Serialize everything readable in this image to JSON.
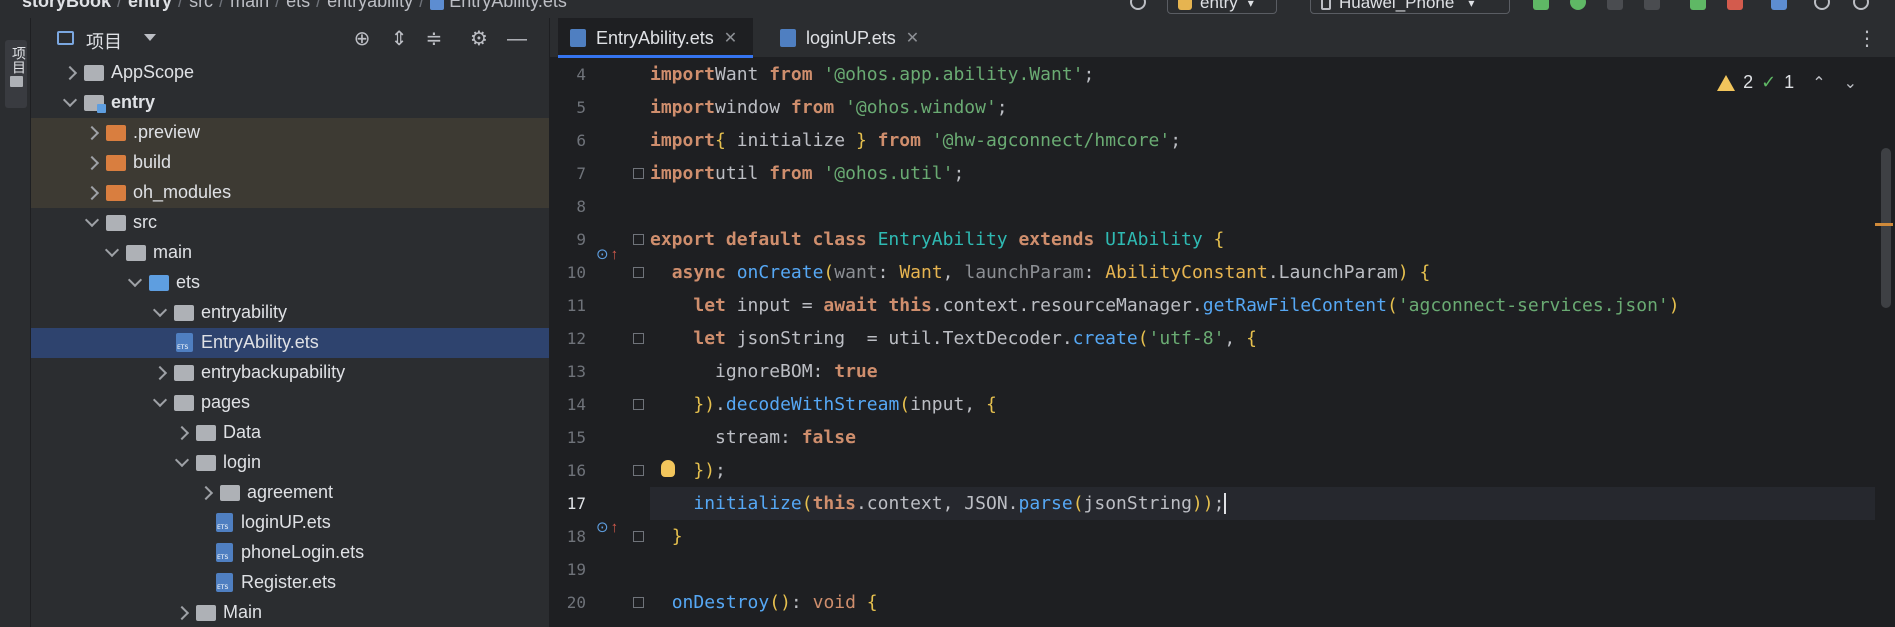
{
  "topbar": {
    "breadcrumb": [
      "storyBook",
      "entry",
      "src",
      "main",
      "ets",
      "entryability",
      "EntryAbility.ets"
    ],
    "run_config": "entry",
    "device": "Huawei_Phone"
  },
  "stripe": {
    "project_tab_label": "项目"
  },
  "project_panel": {
    "title": "项目",
    "tree": [
      {
        "label": "AppScope",
        "depth": 0,
        "state": "collapsed",
        "icon": "folder-gray"
      },
      {
        "label": "entry",
        "depth": 0,
        "state": "expanded",
        "icon": "module",
        "bold": true
      },
      {
        "label": ".preview",
        "depth": 1,
        "state": "collapsed",
        "icon": "folder-orange",
        "excluded": true
      },
      {
        "label": "build",
        "depth": 1,
        "state": "collapsed",
        "icon": "folder-orange",
        "excluded": true
      },
      {
        "label": "oh_modules",
        "depth": 1,
        "state": "collapsed",
        "icon": "folder-orange",
        "excluded": true
      },
      {
        "label": "src",
        "depth": 1,
        "state": "expanded",
        "icon": "folder-gray"
      },
      {
        "label": "main",
        "depth": 2,
        "state": "expanded",
        "icon": "folder-gray"
      },
      {
        "label": "ets",
        "depth": 3,
        "state": "expanded",
        "icon": "folder-blue"
      },
      {
        "label": "entryability",
        "depth": 4,
        "state": "expanded",
        "icon": "folder-gray"
      },
      {
        "label": "EntryAbility.ets",
        "depth": 5,
        "state": "file",
        "icon": "ets",
        "selected": true
      },
      {
        "label": "entrybackupability",
        "depth": 4,
        "state": "collapsed",
        "icon": "folder-gray"
      },
      {
        "label": "pages",
        "depth": 4,
        "state": "expanded",
        "icon": "folder-gray"
      },
      {
        "label": "Data",
        "depth": 5,
        "state": "collapsed",
        "icon": "folder-gray"
      },
      {
        "label": "login",
        "depth": 5,
        "state": "expanded",
        "icon": "folder-gray"
      },
      {
        "label": "agreement",
        "depth": 6,
        "state": "collapsed",
        "icon": "folder-gray"
      },
      {
        "label": "loginUP.ets",
        "depth": 7,
        "state": "file",
        "icon": "ets"
      },
      {
        "label": "phoneLogin.ets",
        "depth": 7,
        "state": "file",
        "icon": "ets"
      },
      {
        "label": "Register.ets",
        "depth": 7,
        "state": "file",
        "icon": "ets"
      },
      {
        "label": "Main",
        "depth": 5,
        "state": "collapsed",
        "icon": "folder-gray"
      }
    ]
  },
  "editor": {
    "tabs": [
      {
        "label": "EntryAbility.ets",
        "active": true
      },
      {
        "label": "loginUP.ets",
        "active": false
      }
    ],
    "inspections": {
      "warnings": "2",
      "weak_warnings": "1"
    },
    "current_line": 17,
    "lines": [
      {
        "n": "4",
        "segs": [
          [
            "kw",
            "import"
          ],
          [
            "",
            "Want "
          ],
          [
            "kw",
            "from "
          ],
          [
            "str",
            "'@ohos.app.ability.Want'"
          ],
          [
            "",
            ";"
          ]
        ]
      },
      {
        "n": "5",
        "segs": [
          [
            "kw",
            "import"
          ],
          [
            "",
            "window "
          ],
          [
            "kw",
            "from "
          ],
          [
            "str",
            "'@ohos.window'"
          ],
          [
            "",
            ";"
          ]
        ]
      },
      {
        "n": "6",
        "segs": [
          [
            "kw",
            "import"
          ],
          [
            "brace",
            "{ "
          ],
          [
            "",
            "initialize "
          ],
          [
            "brace",
            "} "
          ],
          [
            "kw",
            "from "
          ],
          [
            "str",
            "'@hw-agconnect/hmcore'"
          ],
          [
            "",
            ";"
          ]
        ]
      },
      {
        "n": "7",
        "segs": [
          [
            "kw",
            "import"
          ],
          [
            "",
            "util "
          ],
          [
            "kw",
            "from "
          ],
          [
            "str",
            "'@ohos.util'"
          ],
          [
            "",
            ";"
          ]
        ]
      },
      {
        "n": "8",
        "segs": []
      },
      {
        "n": "9",
        "segs": [
          [
            "kw",
            "export default class "
          ],
          [
            "type",
            "EntryAbility "
          ],
          [
            "kw",
            "extends "
          ],
          [
            "type",
            "UIAbility "
          ],
          [
            "brace",
            "{"
          ]
        ]
      },
      {
        "n": "10",
        "segs": [
          [
            "",
            "  "
          ],
          [
            "kw",
            "async "
          ],
          [
            "fn",
            "onCreate"
          ],
          [
            "brace",
            "("
          ],
          [
            "param",
            "want"
          ],
          [
            "",
            ": "
          ],
          [
            "typeo",
            "Want"
          ],
          [
            "",
            ", "
          ],
          [
            "param",
            "launchParam"
          ],
          [
            "",
            ": "
          ],
          [
            "typeo",
            "AbilityConstant"
          ],
          [
            "",
            ".LaunchParam"
          ],
          [
            "brace",
            ")"
          ],
          [
            "brace",
            " {"
          ]
        ]
      },
      {
        "n": "11",
        "segs": [
          [
            "",
            "    "
          ],
          [
            "kw",
            "let "
          ],
          [
            "",
            "input = "
          ],
          [
            "kw",
            "await "
          ],
          [
            "kw",
            "this"
          ],
          [
            "",
            ".context.resourceManager."
          ],
          [
            "fn",
            "getRawFileContent"
          ],
          [
            "brace",
            "("
          ],
          [
            "str",
            "'agconnect-services.json'"
          ],
          [
            "brace",
            ")"
          ]
        ]
      },
      {
        "n": "12",
        "segs": [
          [
            "",
            "    "
          ],
          [
            "kw",
            "let "
          ],
          [
            "",
            "jsonString  = util.TextDecoder."
          ],
          [
            "fn",
            "create"
          ],
          [
            "brace",
            "("
          ],
          [
            "str",
            "'utf-8'"
          ],
          [
            "",
            ", "
          ],
          [
            "brace",
            "{"
          ]
        ]
      },
      {
        "n": "13",
        "segs": [
          [
            "",
            "      ignoreBOM: "
          ],
          [
            "kw",
            "true"
          ]
        ]
      },
      {
        "n": "14",
        "segs": [
          [
            "",
            "    "
          ],
          [
            "brace",
            "})"
          ],
          [
            "",
            "."
          ],
          [
            "fn",
            "decodeWithStream"
          ],
          [
            "brace",
            "("
          ],
          [
            "",
            "input, "
          ],
          [
            "brace",
            "{"
          ]
        ]
      },
      {
        "n": "15",
        "segs": [
          [
            "",
            "      stream: "
          ],
          [
            "kw",
            "false"
          ]
        ]
      },
      {
        "n": "16",
        "segs": [
          [
            "",
            "    "
          ],
          [
            "brace",
            "})"
          ],
          [
            "",
            ";"
          ]
        ]
      },
      {
        "n": "17",
        "segs": [
          [
            "",
            "    "
          ],
          [
            "fn",
            "initialize"
          ],
          [
            "brace",
            "("
          ],
          [
            "kw",
            "this"
          ],
          [
            "",
            ".context, JSON."
          ],
          [
            "fn",
            "parse"
          ],
          [
            "brace",
            "("
          ],
          [
            "",
            "jsonString"
          ],
          [
            "brace",
            "))"
          ],
          [
            "",
            ";"
          ]
        ]
      },
      {
        "n": "18",
        "segs": [
          [
            "",
            "  "
          ],
          [
            "brace",
            "}"
          ]
        ]
      },
      {
        "n": "19",
        "segs": []
      },
      {
        "n": "20",
        "segs": [
          [
            "",
            "  "
          ],
          [
            "fn",
            "onDestroy"
          ],
          [
            "brace",
            "()"
          ],
          [
            "",
            ": "
          ],
          [
            "kwn",
            "void "
          ],
          [
            "brace",
            "{"
          ]
        ]
      }
    ]
  }
}
